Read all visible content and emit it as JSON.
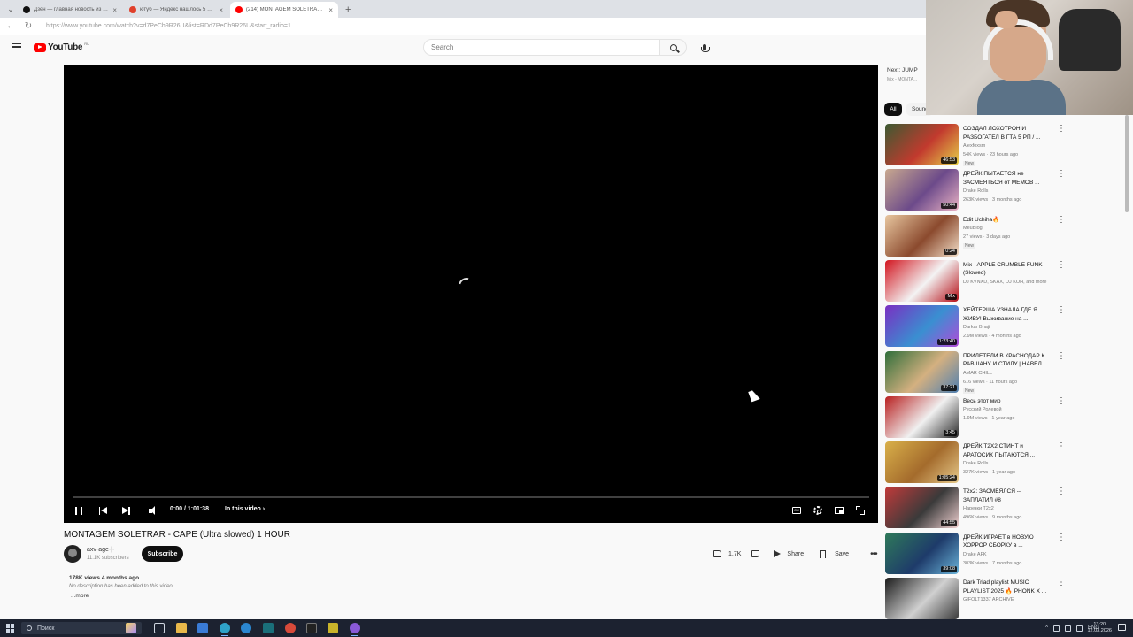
{
  "browser": {
    "tabs": [
      {
        "label": "Дзен — главная новость из инфо",
        "favicon_color": "#111111",
        "active": false
      },
      {
        "label": "ютуб — Яндекс нашлось 5 млн р",
        "favicon_color": "#e0402b",
        "active": false
      },
      {
        "label": "(214) MONTAGEM SOLETRAR - CAPE",
        "favicon_color": "#ff0000",
        "active": true
      }
    ],
    "new_tab_label": "+",
    "url": "https://www.youtube.com/watch?v=d7PeCh9R26U&list=RDd7PeCh9R26U&start_radio=1"
  },
  "header": {
    "logo_text": "YouTube",
    "logo_country": "RU",
    "search_placeholder": "Search"
  },
  "player": {
    "time": "0:00 / 1:01:38",
    "in_this_video": "In this video",
    "progress": 0.0,
    "subtitle_icon_text": "CC"
  },
  "video": {
    "title": "MONTAGEM SOLETRAR - CAPE (Ultra slowed) 1 HOUR",
    "channel_name": "axv-age-|-",
    "channel_subs": "11.1K subscribers",
    "subscribe_label": "Subscribe",
    "likes": "1.7K",
    "share_label": "Share",
    "save_label": "Save",
    "views_date": "178K views  4 months ago",
    "description": "No description has been added to this video.",
    "more_label": "...more"
  },
  "sidebar": {
    "next_label": "Next: JUMP",
    "next_sub": "Mix - MONTA...",
    "chips": [
      "All",
      "Sounds"
    ],
    "recommendations": [
      {
        "title": "СОЗДАЛ ЛОХОТРОН И РАЗБОГАТЕЛ В ГТА 5 РП / ...",
        "channel": "Alexfoxsm",
        "meta": "54K views · 23 hours ago",
        "badge": "New",
        "duration": "46:53",
        "colors": [
          "#3c5a32",
          "#c23a2e",
          "#e6d14a"
        ]
      },
      {
        "title": "ДРЕЙК ПЫТАЕТСЯ не ЗАСМЕЯТЬСЯ от МЕМОВ ...",
        "channel": "Drake Rolls",
        "meta": "263K views · 3 months ago",
        "badge": "",
        "duration": "50:44",
        "colors": [
          "#c9a98f",
          "#6c4a8a",
          "#e9b2c4"
        ]
      },
      {
        "title": "Edit Uchiha🔥",
        "channel": "MeuBlog",
        "meta": "27 views · 3 days ago",
        "badge": "New",
        "duration": "0:24",
        "colors": [
          "#e8c7a0",
          "#8b4a2e",
          "#f3dfc8"
        ]
      },
      {
        "title": "Mix - APPLE CRUMBLE FUNK (Slowed)",
        "channel": "DJ KVNXD, SKAX, DJ KOH, and more",
        "meta": "",
        "badge": "",
        "duration": "Mix",
        "colors": [
          "#d2141e",
          "#f3f3f3",
          "#b60f17"
        ]
      },
      {
        "title": "ХЕЙТЕРША УЗНАЛА ГДЕ Я ЖИВУ! Выживание на ...",
        "channel": "Darkar Bhaji",
        "meta": "2.9M views · 4 months ago",
        "badge": "",
        "duration": "1:23:40",
        "colors": [
          "#7a2fc2",
          "#3a8fd1",
          "#b14bd9"
        ]
      },
      {
        "title": "ПРИЛЕТЕЛИ В КРАСНОДАР К РАВШАНУ И СТИЛУ | НАВЕЛ...",
        "channel": "AMAR CHILL",
        "meta": "616 views · 11 hours ago",
        "badge": "New",
        "duration": "37:21",
        "colors": [
          "#2f6e3a",
          "#d4b080",
          "#4f7fb0"
        ]
      },
      {
        "title": "Весь этот мир",
        "channel": "Русский Ролевой",
        "meta": "1.9M views · 1 year ago",
        "badge": "",
        "duration": "3:45",
        "colors": [
          "#b81f1f",
          "#f0f0f0",
          "#2a2a2a"
        ]
      },
      {
        "title": "ДРЕЙК Т2Х2 СТИНТ и АРАТОСИК ПЫТАЮТСЯ ...",
        "channel": "Drake Rolls",
        "meta": "327K views · 1 year ago",
        "badge": "",
        "duration": "1:05:24",
        "colors": [
          "#d9b04a",
          "#a46b2c",
          "#e6c98a"
        ]
      },
      {
        "title": "Т2х2: ЗАСМЕЯЛСЯ -- ЗАПЛАТИЛ #8",
        "channel": "Нарезки T2x2",
        "meta": "496K views · 9 months ago",
        "badge": "",
        "duration": "44:55",
        "colors": [
          "#c23a3a",
          "#3a3a3a",
          "#f0d0d0"
        ]
      },
      {
        "title": "ДРЕЙК ИГРАЕТ в НОВУЮ ХОРРОР СБОРКУ в ...",
        "channel": "Drake AFK",
        "meta": "303K views · 7 months ago",
        "badge": "",
        "duration": "39:08",
        "colors": [
          "#2f7a5a",
          "#1e3b6a",
          "#6ab3d9"
        ]
      },
      {
        "title": "Dark Triad playlist MUSIC PLAYLIST 2025 🔥 PHONK X ...",
        "channel": "GIFOLT1337 ARCHIVE",
        "meta": "",
        "badge": "",
        "duration": "",
        "colors": [
          "#1a1a1a",
          "#d0d0d0",
          "#3a3a3a"
        ]
      }
    ]
  },
  "taskbar": {
    "search_label": "Поиск",
    "lang": "ENG",
    "time": "13:20",
    "date": "12.03.2026"
  }
}
